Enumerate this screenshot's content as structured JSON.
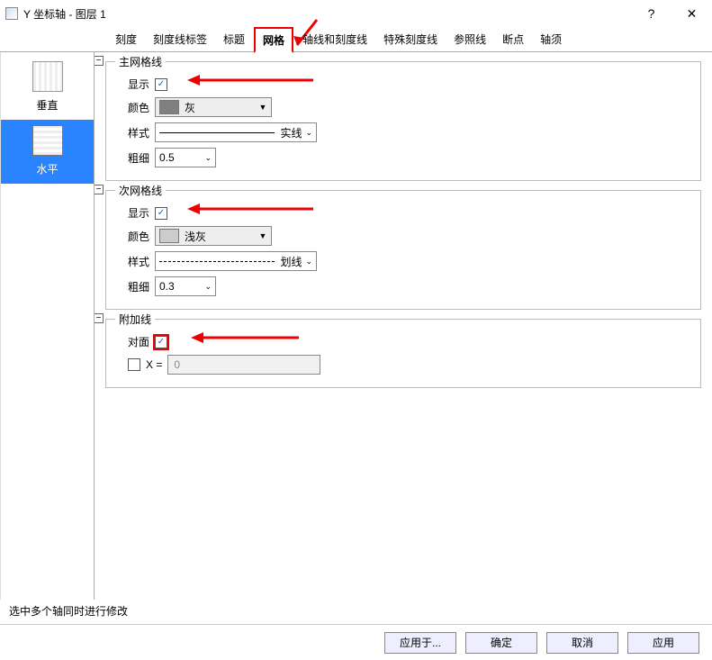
{
  "window": {
    "title": "Y 坐标轴 - 图层 1",
    "help": "?",
    "close": "✕"
  },
  "tabs": {
    "items": [
      {
        "id": "scale",
        "label": "刻度"
      },
      {
        "id": "scale-label",
        "label": "刻度线标签"
      },
      {
        "id": "title",
        "label": "标题"
      },
      {
        "id": "grid",
        "label": "网格",
        "active": true
      },
      {
        "id": "axis-scale",
        "label": "轴线和刻度线"
      },
      {
        "id": "special-scale",
        "label": "特殊刻度线"
      },
      {
        "id": "reference",
        "label": "参照线"
      },
      {
        "id": "breaks",
        "label": "断点"
      },
      {
        "id": "axis-arrow",
        "label": "轴须"
      }
    ]
  },
  "sidebar": {
    "items": [
      {
        "id": "vertical",
        "label": "垂直",
        "selected": false
      },
      {
        "id": "horizontal",
        "label": "水平",
        "selected": true
      }
    ]
  },
  "groups": {
    "major": {
      "title": "主网格线",
      "show_label": "显示",
      "show_checked": true,
      "color_label": "颜色",
      "color_value": "灰",
      "style_label": "样式",
      "style_value": "实线",
      "thickness_label": "粗细",
      "thickness_value": "0.5"
    },
    "minor": {
      "title": "次网格线",
      "show_label": "显示",
      "show_checked": true,
      "color_label": "颜色",
      "color_value": "浅灰",
      "style_label": "样式",
      "style_value": "划线",
      "thickness_label": "粗细",
      "thickness_value": "0.3"
    },
    "additional": {
      "title": "附加线",
      "opposite_label": "对面",
      "opposite_checked": true,
      "x_check_label": "X =",
      "x_value": "0"
    }
  },
  "footer": {
    "note": "选中多个轴同时进行修改",
    "apply_to": "应用于...",
    "ok": "确定",
    "cancel": "取消",
    "apply": "应用"
  }
}
